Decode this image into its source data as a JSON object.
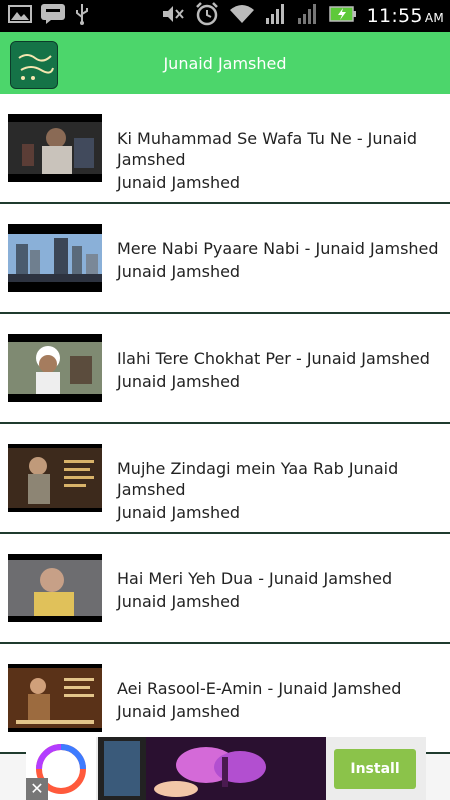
{
  "status_bar": {
    "time": "11:55",
    "ampm": "AM",
    "icons": [
      "image-icon",
      "chat-icon",
      "usb-icon",
      "mute-icon",
      "alarm-icon",
      "wifi-icon",
      "signal-icon",
      "signal-icon",
      "battery-charging-icon"
    ]
  },
  "app_bar": {
    "title": "Junaid Jamshed",
    "logo_text": "نعت رسول مقبول"
  },
  "videos": [
    {
      "title": "Ki Muhammad Se Wafa Tu Ne - Junaid Jamshed",
      "artist": "Junaid Jamshed"
    },
    {
      "title": "Mere Nabi Pyaare Nabi - Junaid Jamshed",
      "artist": "Junaid Jamshed"
    },
    {
      "title": "Ilahi Tere Chokhat Per - Junaid Jamshed",
      "artist": "Junaid Jamshed"
    },
    {
      "title": "Mujhe Zindagi mein Yaa Rab Junaid Jamshed",
      "artist": "Junaid Jamshed"
    },
    {
      "title": "Hai Meri Yeh Dua - Junaid Jamshed",
      "artist": "Junaid Jamshed"
    },
    {
      "title": "Aei Rasool-E-Amin - Junaid Jamshed",
      "artist": "Junaid Jamshed"
    }
  ],
  "ad": {
    "install_label": "Install",
    "close_label": "✕"
  },
  "colors": {
    "accent": "#4cd66b",
    "divider": "#1f3b2e",
    "install": "#8bc34a"
  }
}
